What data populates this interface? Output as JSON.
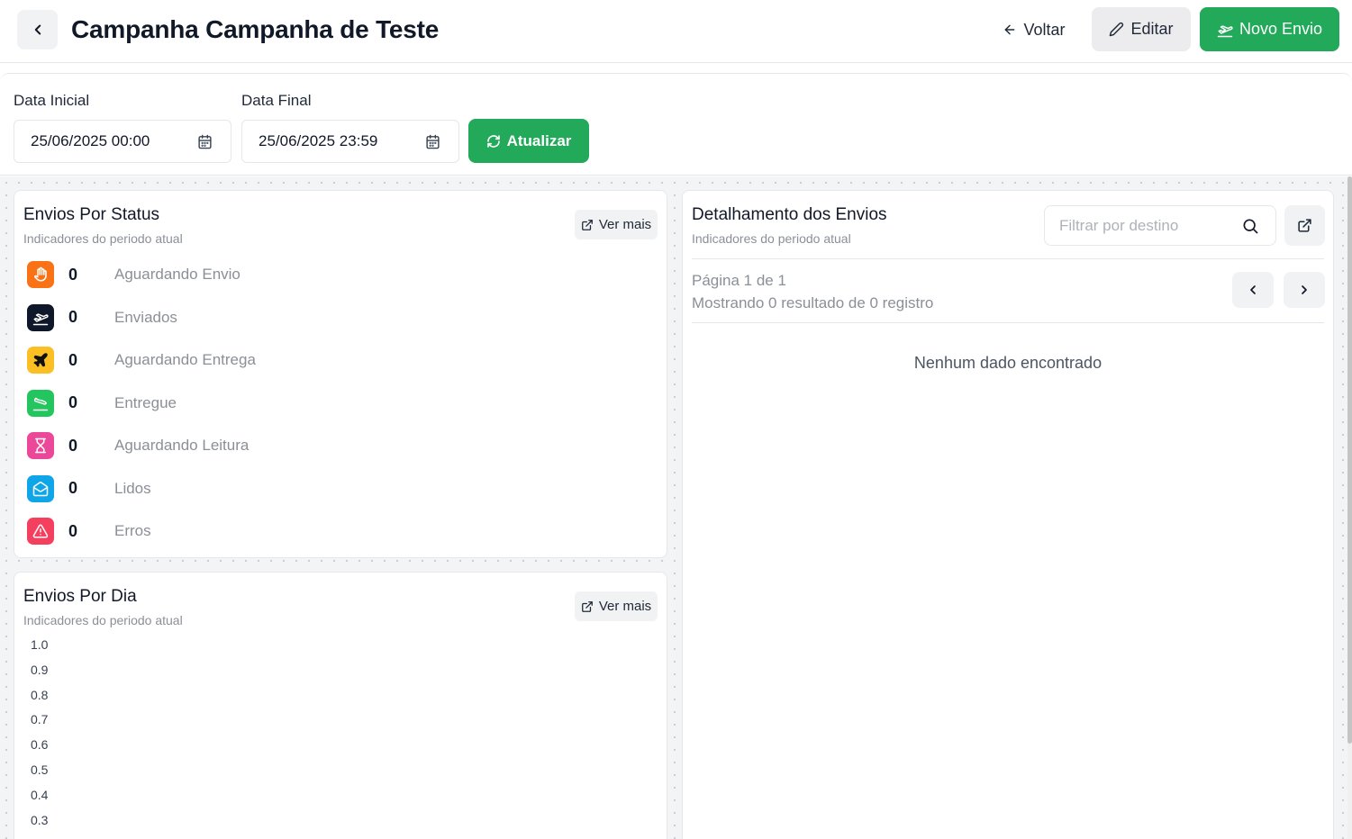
{
  "header": {
    "title": "Campanha Campanha de Teste",
    "voltar_label": "Voltar",
    "editar_label": "Editar",
    "novo_envio_label": "Novo Envio"
  },
  "filters": {
    "start_label": "Data Inicial",
    "start_value": "25/06/2025 00:00",
    "end_label": "Data Final",
    "end_value": "25/06/2025 23:59",
    "refresh_label": "Atualizar"
  },
  "status_card": {
    "title": "Envios Por Status",
    "subtitle": "Indicadores do periodo atual",
    "ver_mais": "Ver mais",
    "items": [
      {
        "count": "0",
        "label": "Aguardando Envio",
        "color": "#f97316",
        "icon": "hand-icon"
      },
      {
        "count": "0",
        "label": "Enviados",
        "color": "#0f172a",
        "icon": "plane-takeoff-icon"
      },
      {
        "count": "0",
        "label": "Aguardando Entrega",
        "color": "#fbbf24",
        "icon": "plane-icon"
      },
      {
        "count": "0",
        "label": "Entregue",
        "color": "#22c55e",
        "icon": "plane-landing-icon"
      },
      {
        "count": "0",
        "label": "Aguardando Leitura",
        "color": "#ec4899",
        "icon": "hourglass-icon"
      },
      {
        "count": "0",
        "label": "Lidos",
        "color": "#0ea5e9",
        "icon": "mail-open-icon"
      },
      {
        "count": "0",
        "label": "Erros",
        "color": "#f43f5e",
        "icon": "alert-triangle-icon"
      }
    ]
  },
  "day_card": {
    "title": "Envios Por Dia",
    "subtitle": "Indicadores do periodo atual",
    "ver_mais": "Ver mais"
  },
  "chart_data": {
    "type": "bar",
    "title": "Envios Por Dia",
    "categories": [],
    "values": [],
    "ylim": [
      0,
      1.0
    ],
    "yticks": [
      "1.0",
      "0.9",
      "0.8",
      "0.7",
      "0.6",
      "0.5",
      "0.4",
      "0.3"
    ]
  },
  "detail_card": {
    "title": "Detalhamento dos Envios",
    "subtitle": "Indicadores do periodo atual",
    "search_placeholder": "Filtrar por destino",
    "page_text": "Página 1 de 1",
    "showing_text": "Mostrando 0 resultado de 0 registro",
    "empty_text": "Nenhum dado encontrado"
  }
}
